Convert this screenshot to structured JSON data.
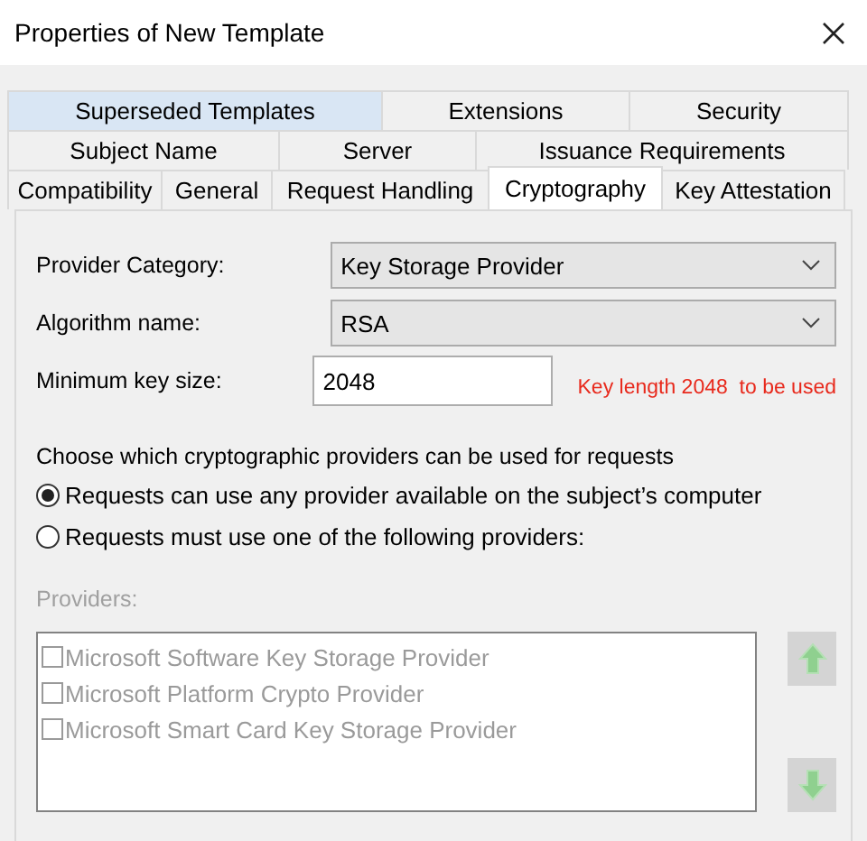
{
  "window": {
    "title": "Properties of New Template"
  },
  "tab_rows": [
    [
      {
        "label": "Superseded Templates",
        "selected": false,
        "hovered": true
      },
      {
        "label": "Extensions",
        "selected": false,
        "hovered": false
      },
      {
        "label": "Security",
        "selected": false,
        "hovered": false
      }
    ],
    [
      {
        "label": "Subject Name",
        "selected": false,
        "hovered": false
      },
      {
        "label": "Server",
        "selected": false,
        "hovered": false
      },
      {
        "label": "Issuance Requirements",
        "selected": false,
        "hovered": false
      }
    ],
    [
      {
        "label": "Compatibility",
        "selected": false,
        "hovered": false
      },
      {
        "label": "General",
        "selected": false,
        "hovered": false
      },
      {
        "label": "Request Handling",
        "selected": false,
        "hovered": false
      },
      {
        "label": "Cryptography",
        "selected": true,
        "hovered": false
      },
      {
        "label": "Key Attestation",
        "selected": false,
        "hovered": false
      }
    ]
  ],
  "fields": [
    {
      "kind": "combo",
      "label": "Provider Category:",
      "value": "Key Storage Provider"
    },
    {
      "kind": "combo",
      "label": "Algorithm name:",
      "value": "RSA"
    },
    {
      "kind": "input",
      "label": "Minimum key size:",
      "value": "2048",
      "note": "Key length 2048  to be used"
    }
  ],
  "providers_prompt": "Choose which cryptographic providers can be used for requests",
  "options": [
    {
      "label": "Requests can use any provider available on the subject’s computer",
      "selected": true
    },
    {
      "label": "Requests must use one of the following providers:",
      "selected": false
    }
  ],
  "providers": {
    "label": "Providers:",
    "disabled": true,
    "items": [
      {
        "label": "Microsoft Software Key Storage Provider",
        "checked": false
      },
      {
        "label": "Microsoft Platform Crypto Provider",
        "checked": false
      },
      {
        "label": "Microsoft Smart Card Key Storage Provider",
        "checked": false
      }
    ]
  }
}
